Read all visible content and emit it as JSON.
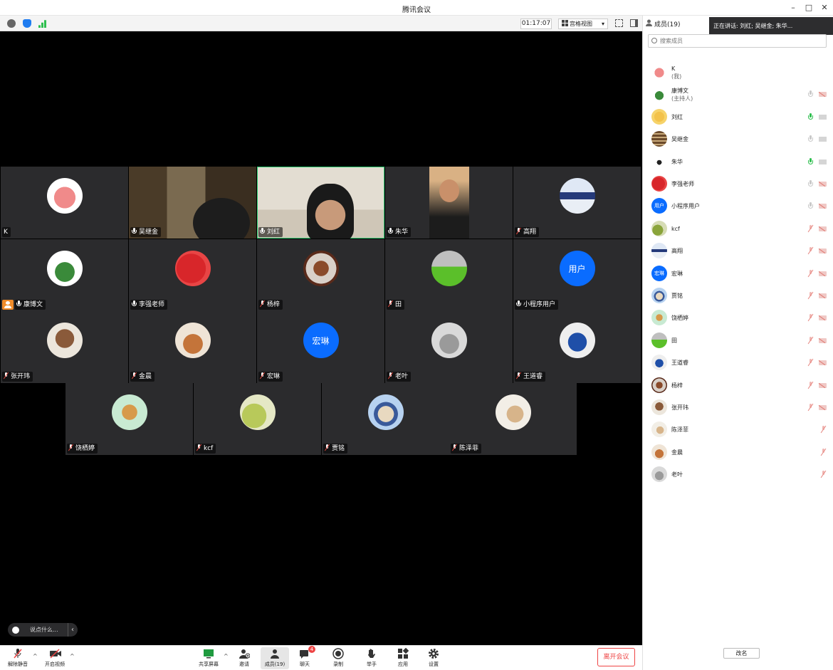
{
  "window": {
    "title": "腾讯会议",
    "controls": [
      "minimize",
      "maximize",
      "close"
    ]
  },
  "toolbar": {
    "timer": "01:17:07",
    "view_label": "宫格视图",
    "icons": [
      "info-icon",
      "shield-icon",
      "signal-icon"
    ]
  },
  "colors": {
    "accent": "#0a6cff",
    "danger": "#e44444",
    "host_badge": "#f08c2a",
    "speaking": "#2fbf4f"
  },
  "tiles": [
    {
      "name": "K",
      "kind": "avatar",
      "mic": "none"
    },
    {
      "name": "吴继金",
      "kind": "video",
      "mic": "on"
    },
    {
      "name": "刘红",
      "kind": "video",
      "mic": "on",
      "active": true
    },
    {
      "name": "朱华",
      "kind": "video",
      "mic": "on"
    },
    {
      "name": "高翔",
      "kind": "avatar",
      "mic": "off"
    },
    {
      "name": "康博文",
      "kind": "avatar",
      "mic": "on",
      "host": true
    },
    {
      "name": "李强老师",
      "kind": "avatar",
      "mic": "on"
    },
    {
      "name": "杨梓",
      "kind": "avatar",
      "mic": "off"
    },
    {
      "name": "田",
      "kind": "avatar",
      "mic": "off"
    },
    {
      "name": "小程序用户",
      "kind": "avatar",
      "mic": "on",
      "avatar_text": "用户"
    },
    {
      "name": "张开玮",
      "kind": "avatar",
      "mic": "off"
    },
    {
      "name": "金晨",
      "kind": "avatar",
      "mic": "off"
    },
    {
      "name": "宏琳",
      "kind": "avatar",
      "mic": "off",
      "avatar_text": "宏琳"
    },
    {
      "name": "老叶",
      "kind": "avatar",
      "mic": "off"
    },
    {
      "name": "王道睿",
      "kind": "avatar",
      "mic": "off"
    },
    {
      "name": "饶栖婷",
      "kind": "avatar",
      "mic": "off"
    },
    {
      "name": "kcf",
      "kind": "avatar",
      "mic": "off"
    },
    {
      "name": "贾铭",
      "kind": "avatar",
      "mic": "off"
    },
    {
      "name": "陈泽菲",
      "kind": "avatar",
      "mic": "off"
    }
  ],
  "chat": {
    "placeholder": "说点什么..."
  },
  "bottombar": {
    "unmute": "解除静音",
    "start_video": "开启视频",
    "share_screen": "共享屏幕",
    "invite": "邀请",
    "members": "成员(19)",
    "chat": "聊天",
    "chat_badge": "4",
    "record": "录制",
    "raise_hand": "举手",
    "apps": "应用",
    "settings": "设置",
    "leave": "离开会议"
  },
  "panel": {
    "title": "成员(19)",
    "speaking": "正在讲话: 刘红; 吴继金; 朱华...",
    "search_placeholder": "搜索成员",
    "rename": "改名",
    "members": [
      {
        "name": "K",
        "sub": "(我)",
        "mic": "none",
        "cam": "none"
      },
      {
        "name": "康博文",
        "sub": "(主持人)",
        "mic": "grey",
        "cam": "off"
      },
      {
        "name": "刘红",
        "mic": "green",
        "cam": "grey"
      },
      {
        "name": "吴继金",
        "mic": "grey",
        "cam": "grey"
      },
      {
        "name": "朱华",
        "mic": "green",
        "cam": "grey"
      },
      {
        "name": "李强老师",
        "mic": "grey",
        "cam": "off"
      },
      {
        "name": "小程序用户",
        "mic": "grey",
        "cam": "off",
        "avatar_text": "用户"
      },
      {
        "name": "kcf",
        "mic": "off",
        "cam": "off"
      },
      {
        "name": "高翔",
        "mic": "off",
        "cam": "off"
      },
      {
        "name": "宏琳",
        "mic": "off",
        "cam": "off",
        "avatar_text": "宏琳"
      },
      {
        "name": "贾铭",
        "mic": "off",
        "cam": "off"
      },
      {
        "name": "饶栖婷",
        "mic": "off",
        "cam": "off"
      },
      {
        "name": "田",
        "mic": "off",
        "cam": "off"
      },
      {
        "name": "王道睿",
        "mic": "off",
        "cam": "off"
      },
      {
        "name": "杨梓",
        "mic": "off",
        "cam": "off"
      },
      {
        "name": "张开玮",
        "mic": "off",
        "cam": "off"
      },
      {
        "name": "陈泽菲",
        "mic": "off",
        "cam": "none"
      },
      {
        "name": "金晨",
        "mic": "off",
        "cam": "none"
      },
      {
        "name": "老叶",
        "mic": "off",
        "cam": "none"
      }
    ]
  }
}
